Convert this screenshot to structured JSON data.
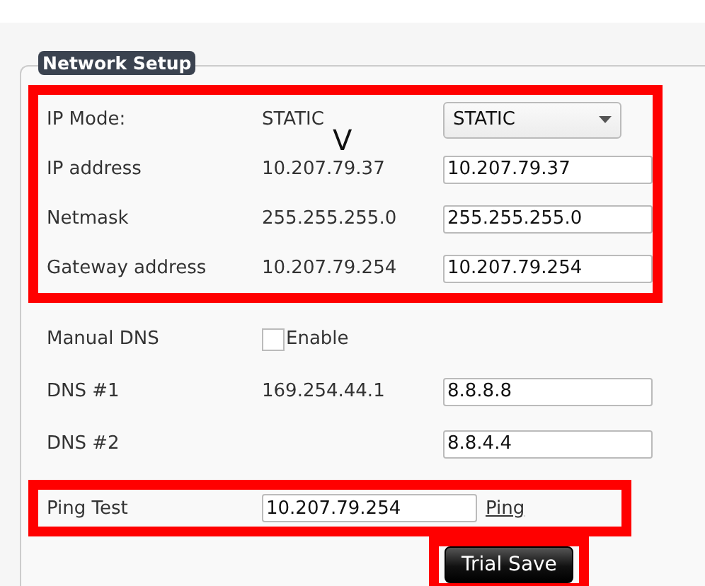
{
  "section": {
    "title": "Network Setup"
  },
  "annotation": "V",
  "groups": [
    {
      "highlighted": true,
      "rows": [
        {
          "kind": "select",
          "label": "IP Mode:",
          "current": "STATIC",
          "value": "STATIC"
        },
        {
          "kind": "input",
          "label": "IP address",
          "current": "10.207.79.37",
          "value": "10.207.79.37"
        },
        {
          "kind": "input",
          "label": "Netmask",
          "current": "255.255.255.0",
          "value": "255.255.255.0"
        },
        {
          "kind": "input",
          "label": "Gateway address",
          "current": "10.207.79.254",
          "value": "10.207.79.254"
        }
      ]
    },
    {
      "highlighted": false,
      "rows": [
        {
          "kind": "checkbox",
          "label": "Manual DNS",
          "option": "Enable",
          "checked": false
        },
        {
          "kind": "input",
          "label": "DNS #1",
          "current": "169.254.44.1",
          "value": "8.8.8.8"
        },
        {
          "kind": "input",
          "label": "DNS #2",
          "value": "8.8.4.4"
        }
      ]
    },
    {
      "highlighted": true,
      "rows": [
        {
          "kind": "ping",
          "label": "Ping Test",
          "value": "10.207.79.254",
          "link": "Ping"
        }
      ]
    }
  ],
  "trial_save": {
    "label": "Trial Save",
    "highlighted": true
  }
}
